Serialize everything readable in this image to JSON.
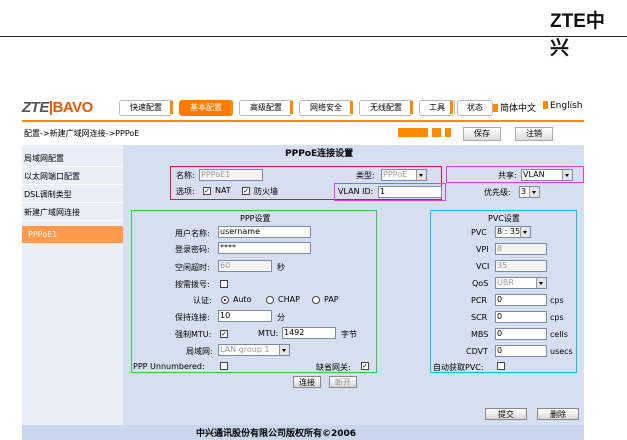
{
  "doc_logo": "ZTE中兴",
  "brand": {
    "zte": "ZTE",
    "sep": "|",
    "bavo": "BAVO"
  },
  "nav": {
    "tabs": [
      "快速配置",
      "基本配置",
      "高级配置",
      "网络安全",
      "无线配置",
      "工具",
      "状态"
    ],
    "active": "基本配置",
    "lang_cn": "简体中文",
    "lang_en": "English"
  },
  "breadcrumb": "配置->新建广域网连接->PPPoE",
  "actions": {
    "save": "保存",
    "logout": "注销"
  },
  "sidebar": {
    "items": [
      "局域网配置",
      "以太网端口配置",
      "DSL调制类型",
      "新建广域网连接"
    ],
    "sub_item": "PPPoE1"
  },
  "title": "PPPoE连接设置",
  "top_form": {
    "name_label": "名称:",
    "name_value": "PPPoE1",
    "type_label": "类型:",
    "type_value": "PPPoE",
    "share_label": "共享:",
    "share_value": "VLAN",
    "options_label": "选项:",
    "nat_label": "NAT",
    "firewall_label": "防火墙",
    "vlan_label": "VLAN ID:",
    "vlan_value": "1",
    "priority_label": "优先级:",
    "priority_value": "3"
  },
  "ppp": {
    "title": "PPP设置",
    "username_label": "用户名称:",
    "username_value": "username",
    "password_label": "登录密码:",
    "password_value": "****",
    "idle_label": "空闲超时:",
    "idle_value": "60",
    "idle_unit": "秒",
    "dialup_label": "按需拨号:",
    "auth_label": "认证:",
    "auth_auto": "Auto",
    "auth_chap": "CHAP",
    "auth_pap": "PAP",
    "keepalive_label": "保持连接:",
    "keepalive_value": "10",
    "keepalive_unit": "分",
    "forcemtu_label": "强制MTU:",
    "mtu_label": "MTU:",
    "mtu_value": "1492",
    "mtu_unit": "字节",
    "lan_label": "局域网:",
    "lan_value": "LAN group 1",
    "unnumbered_label": "PPP Unnumbered:",
    "default_gw_label": "缺省网关:"
  },
  "pvc": {
    "title": "PVC设置",
    "pvc_label": "PVC",
    "pvc_value": "8 : 35",
    "vpi_label": "VPI",
    "vpi_value": "8",
    "vci_label": "VCI",
    "vci_value": "35",
    "qos_label": "QoS",
    "qos_value": "UBR",
    "pcr_label": "PCR",
    "pcr_value": "0",
    "pcr_unit": "cps",
    "scr_label": "SCR",
    "scr_value": "0",
    "scr_unit": "cps",
    "mbs_label": "MBS",
    "mbs_value": "0",
    "mbs_unit": "cells",
    "cdvt_label": "CDVT",
    "cdvt_value": "0",
    "cdvt_unit": "usecs",
    "auto_pvc_label": "自动获取PVC:"
  },
  "buttons": {
    "connect": "连接",
    "disconnect": "断开",
    "submit": "提交",
    "delete": "删除"
  },
  "footer": "中兴通讯股份有限公司版权所有©2006",
  "colors": {
    "accent": "#ff7a00",
    "box_red": "#e0103a",
    "box_magenta": "#e040e0",
    "box_green": "#2ecc40",
    "box_cyan": "#00c8e0",
    "panel": "#d6dff0"
  }
}
